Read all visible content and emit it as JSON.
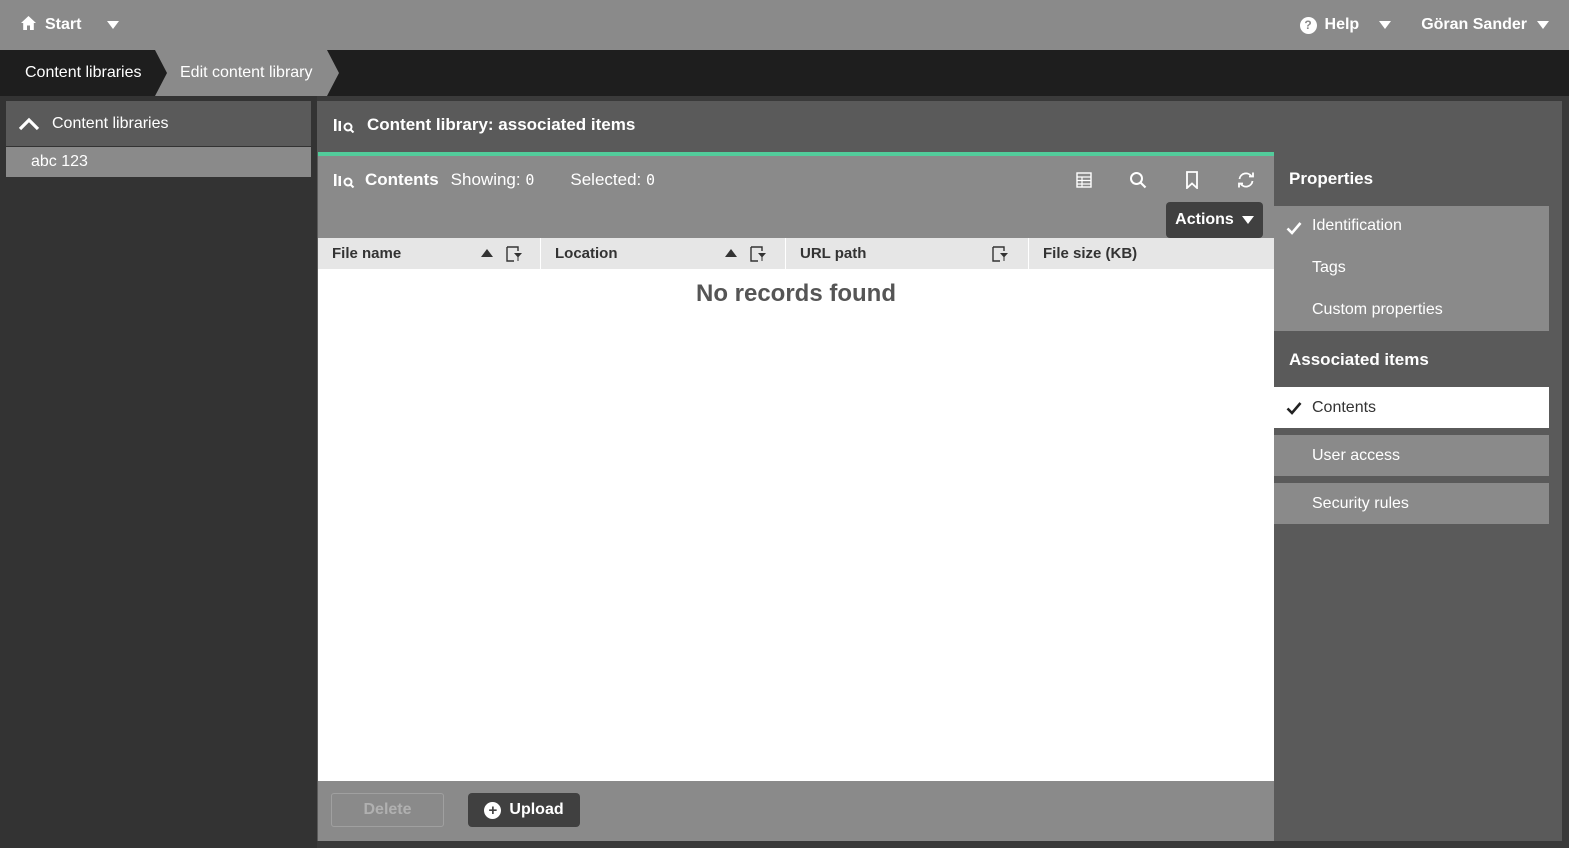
{
  "topbar": {
    "start_label": "Start",
    "help_label": "Help",
    "user_name": "Göran Sander"
  },
  "breadcrumb": {
    "items": [
      "Content libraries",
      "Edit content library"
    ]
  },
  "sidebar": {
    "header": "Content libraries",
    "items": [
      {
        "label": "abc 123"
      }
    ]
  },
  "main": {
    "title": "Content library: associated items",
    "contents": {
      "title": "Contents",
      "showing_label": "Showing:",
      "showing_count": "0",
      "selected_label": "Selected:",
      "selected_count": "0",
      "actions_label": "Actions",
      "columns": [
        "File name",
        "Location",
        "URL path",
        "File size (KB)"
      ],
      "empty_message": "No records found",
      "delete_label": "Delete",
      "upload_label": "Upload"
    }
  },
  "right_panel": {
    "properties_header": "Properties",
    "properties": [
      "Identification",
      "Tags",
      "Custom properties"
    ],
    "associated_header": "Associated items",
    "associated": [
      "Contents",
      "User access",
      "Security rules"
    ]
  },
  "colors": {
    "accent": "#52cc9b",
    "topbar": "#8a8a8a",
    "breadcrumb_bg": "#1e1e1e",
    "panel": "#5a5a5a",
    "button_dark": "#404040"
  },
  "icons": [
    "home-icon",
    "chevron-down-icon",
    "help-icon",
    "chevron-up-icon",
    "qlik-explore-icon",
    "table-view-icon",
    "search-icon",
    "bookmark-icon",
    "refresh-icon",
    "sort-asc-icon",
    "column-filter-icon",
    "checkmark-icon",
    "plus-circle-icon"
  ]
}
